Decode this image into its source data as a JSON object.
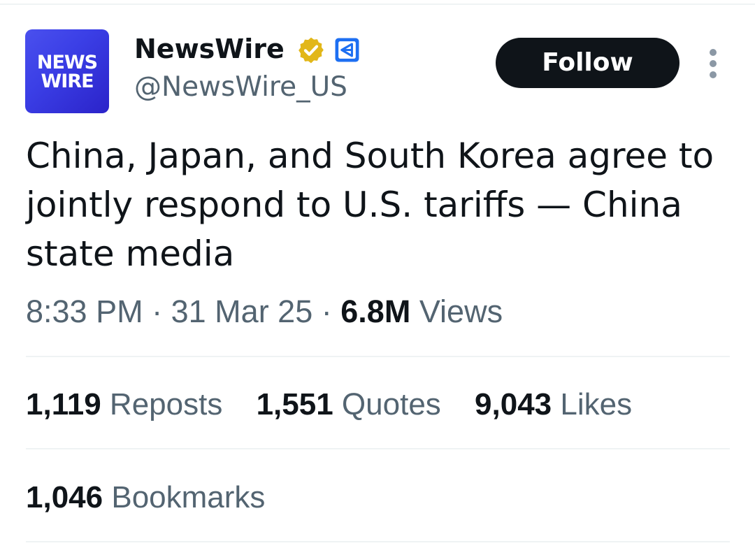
{
  "account": {
    "avatar_text": "NEWS\nWIRE",
    "display_name": "NewsWire",
    "handle": "@NewsWire_US",
    "verified_badge_icon": "gold-verified-check-icon",
    "affiliate_badge_icon": "affiliate-badge-icon"
  },
  "actions": {
    "follow_label": "Follow",
    "more_icon": "vertical-ellipsis-icon"
  },
  "tweet": {
    "text": "China, Japan, and South Korea agree to jointly respond to U.S. tariffs — China state media",
    "time": "8:33 PM",
    "separator": "·",
    "date": "31 Mar 25",
    "views_count": "6.8M",
    "views_label": "Views"
  },
  "stats": {
    "reposts": {
      "count": "1,119",
      "label": "Reposts"
    },
    "quotes": {
      "count": "1,551",
      "label": "Quotes"
    },
    "likes": {
      "count": "9,043",
      "label": "Likes"
    },
    "bookmarks": {
      "count": "1,046",
      "label": "Bookmarks"
    }
  },
  "colors": {
    "text_primary": "#0f1419",
    "text_secondary": "#536471",
    "follow_button_bg": "#0f1419",
    "verified_gold": "#e2b719",
    "affiliate_blue": "#1d6ff2",
    "avatar_blue": "#3b3fe6",
    "divider": "#eff3f4"
  }
}
